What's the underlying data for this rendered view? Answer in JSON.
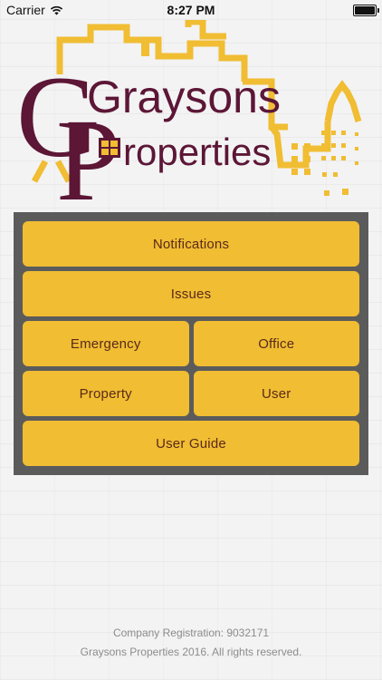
{
  "status_bar": {
    "carrier": "Carrier",
    "time": "8:27 PM",
    "wifi_icon": "wifi-icon",
    "battery_icon": "battery-icon"
  },
  "logo": {
    "word1": "Graysons",
    "word2": "roperties",
    "big_initials": "GP",
    "colors": {
      "maroon": "#5c1636",
      "gold": "#f0bd33"
    }
  },
  "menu": {
    "notifications": "Notifications",
    "issues": "Issues",
    "emergency": "Emergency",
    "office": "Office",
    "property": "Property",
    "user": "User",
    "user_guide": "User Guide"
  },
  "footer": {
    "registration": "Company Registration: 9032171",
    "copyright": "Graysons Properties 2016. All rights reserved."
  },
  "colors": {
    "button": "#f0bd33",
    "button_text": "#5a2a1a",
    "panel": "#5b5b5b",
    "footer_text": "#8c8c8c"
  }
}
